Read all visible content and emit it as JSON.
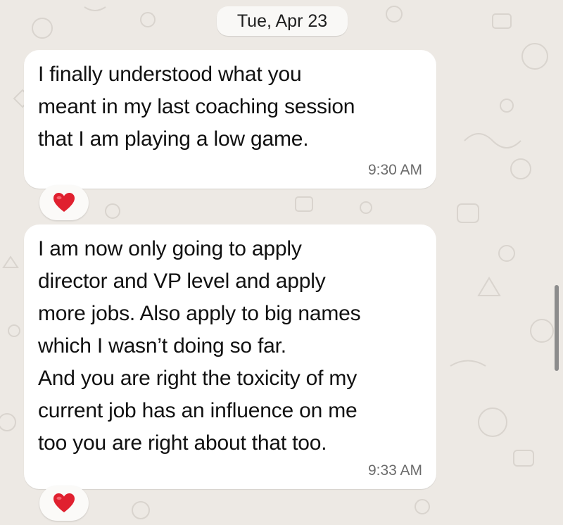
{
  "chat": {
    "date_separator": "Tue, Apr 23",
    "messages": [
      {
        "text": "I finally understood what you\nmeant in my last coaching session\nthat I am playing a low game.",
        "time": "9:30 AM",
        "reaction": "heart-icon"
      },
      {
        "text": "I am now only going to apply\ndirector and VP level and apply\nmore jobs. Also apply to big names\nwhich I wasn’t doing so far.\nAnd you are right the toxicity of my\ncurrent job has an influence on me\ntoo you are right about that too.",
        "time": "9:33 AM",
        "reaction": "heart-icon"
      }
    ]
  },
  "colors": {
    "background": "#ede9e4",
    "bubble": "#ffffff",
    "timestamp": "#6b6b6b",
    "heart": "#e0202f"
  }
}
